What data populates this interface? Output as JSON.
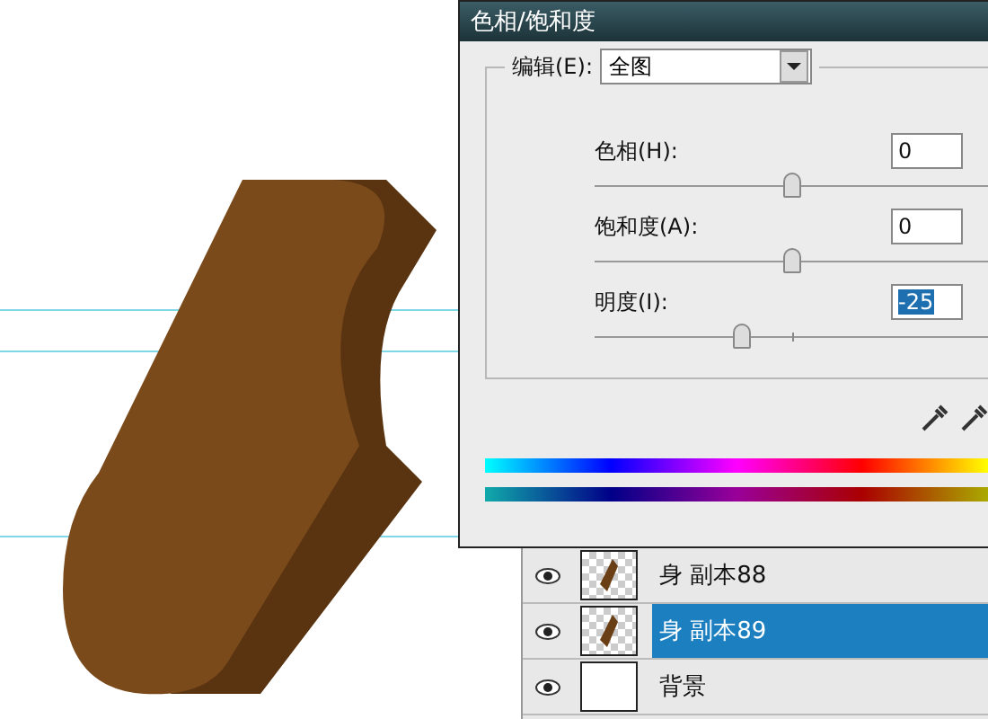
{
  "dialog": {
    "title": "色相/饱和度",
    "edit_label": "编辑(E):",
    "edit_value": "全图",
    "sliders": [
      {
        "label": "色相(H):",
        "value": "0",
        "level": 0.5,
        "highlighted": false
      },
      {
        "label": "饱和度(A):",
        "value": "0",
        "level": 0.5,
        "highlighted": false
      },
      {
        "label": "明度(I):",
        "value": "-25",
        "level": 0.375,
        "highlighted": true
      }
    ]
  },
  "layers": [
    {
      "name": "身 副本88",
      "selected": false,
      "has_shape": true
    },
    {
      "name": "身 副本89",
      "selected": true,
      "has_shape": true
    },
    {
      "name": "背景",
      "selected": false,
      "has_shape": false
    }
  ]
}
